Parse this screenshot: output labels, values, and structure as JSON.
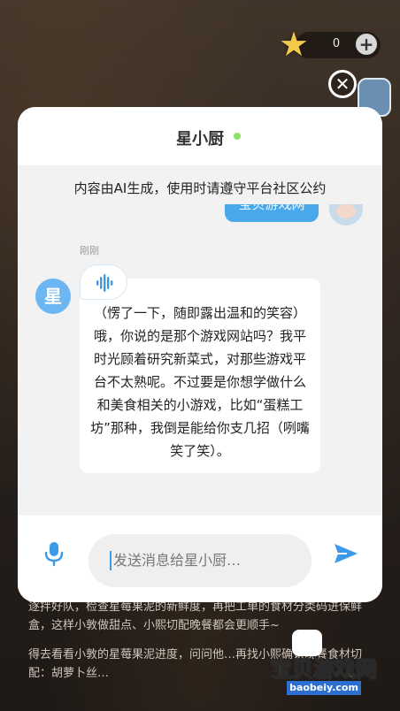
{
  "hud": {
    "coin_count": "0",
    "plus_label": "+",
    "star_glyph": "★"
  },
  "close_label": "✕",
  "panel": {
    "title": "星小厨",
    "notice": "内容由AI生成，使用时请遵守平台社区公约",
    "user_message": "宝贝游戏网",
    "timestamp": "刚刚",
    "bot_avatar_text": "星",
    "bot_message": "（愣了一下，随即露出温和的笑容）哦，你说的是那个游戏网站吗？我平时光顾着研究新菜式，对那些游戏平台不太熟呢。不过要是你想学做什么和美食相关的小游戏，比如“蛋糕工坊”那种，我倒是能给你支几招（咧嘴笑了笑）。",
    "input_placeholder": "发送消息给星小厨…"
  },
  "background_story": [
    "逐拌好队，检查星莓果泥的新鲜度，再把工单的食材分类码进保鲜盒，这样小敦做甜点、小熙切配晚餐都会更顺手~",
    "得去看看小敦的星莓果泥进度，问问他…再找小熙确认晚餐食材切配：胡萝卜丝…"
  ],
  "watermark": {
    "title": "宝贝游戏网",
    "url": "baobeiy.com"
  },
  "colors": {
    "accent": "#49a8ea",
    "online": "#8ee06a",
    "send": "#3b9bea"
  }
}
